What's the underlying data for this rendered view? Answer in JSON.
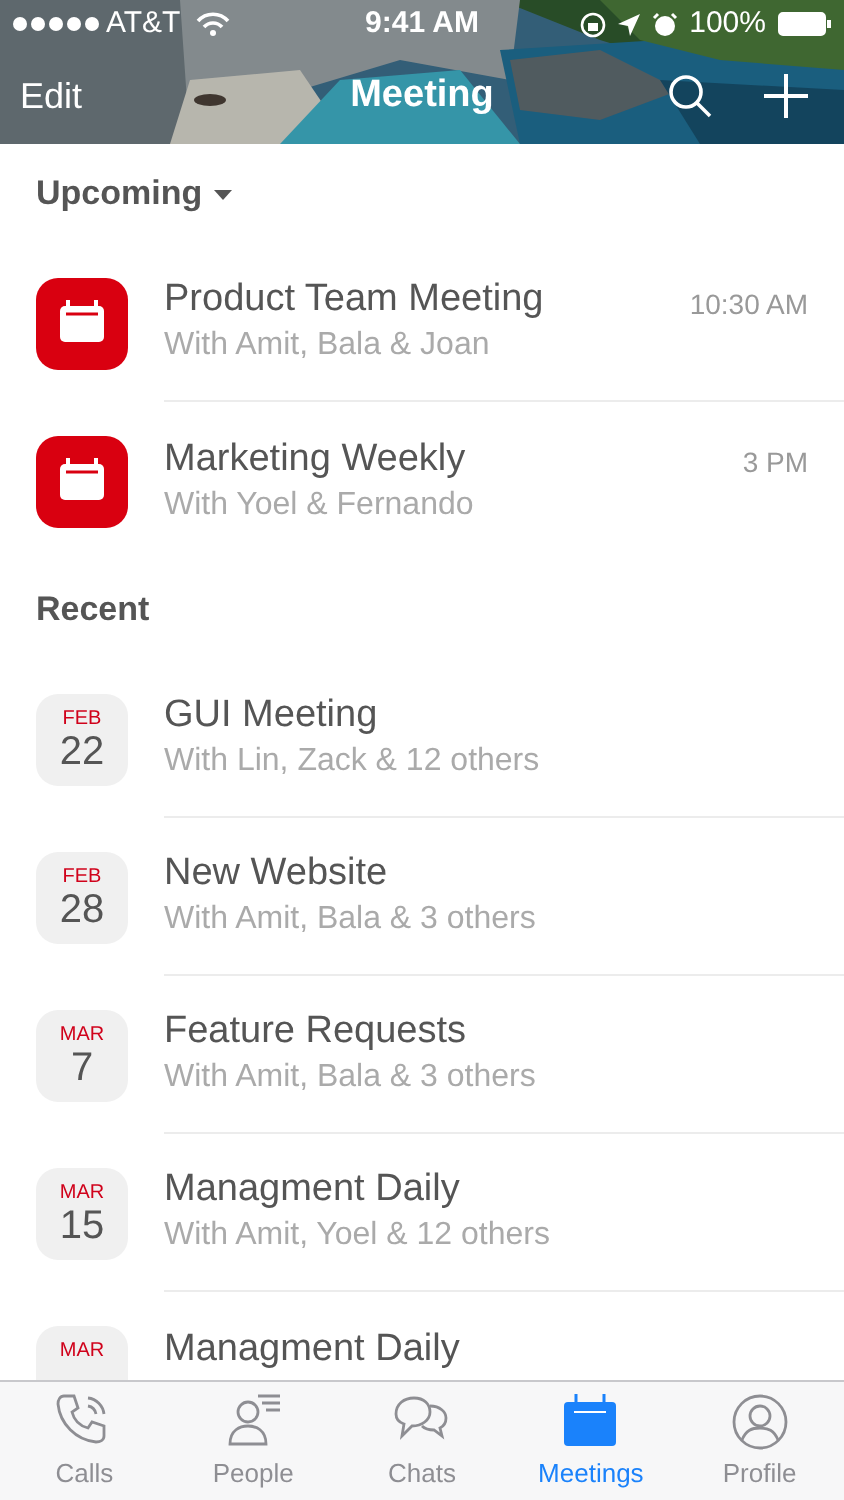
{
  "status_bar": {
    "carrier": "AT&T",
    "time": "9:41 AM",
    "battery": "100%"
  },
  "nav": {
    "left": "Edit",
    "title": "Meeting"
  },
  "sections": [
    {
      "title": "Upcoming",
      "dropdown": true,
      "items": [
        {
          "kind": "upcoming",
          "title": "Product Team Meeting",
          "subtitle": "With Amit, Bala & Joan",
          "time": "10:30 AM"
        },
        {
          "kind": "upcoming",
          "title": "Marketing Weekly",
          "subtitle": "With Yoel & Fernando",
          "time": "3 PM"
        }
      ]
    },
    {
      "title": "Recent",
      "dropdown": false,
      "items": [
        {
          "kind": "recent",
          "month": "FEB",
          "day": "22",
          "title": "GUI Meeting",
          "subtitle": "With Lin, Zack & 12 others"
        },
        {
          "kind": "recent",
          "month": "FEB",
          "day": "28",
          "title": "New Website",
          "subtitle": "With Amit, Bala & 3 others"
        },
        {
          "kind": "recent",
          "month": "MAR",
          "day": "7",
          "title": "Feature Requests",
          "subtitle": "With Amit, Bala & 3 others"
        },
        {
          "kind": "recent",
          "month": "MAR",
          "day": "15",
          "title": "Managment Daily",
          "subtitle": "With Amit, Yoel & 12 others"
        },
        {
          "kind": "recent",
          "month": "MAR",
          "title": "Managment Daily"
        }
      ]
    }
  ],
  "tabs": [
    {
      "kind": "calls",
      "label": "Calls",
      "selected": false
    },
    {
      "kind": "people",
      "label": "People",
      "selected": false
    },
    {
      "kind": "chats",
      "label": "Chats",
      "selected": false
    },
    {
      "kind": "meetings",
      "label": "Meetings",
      "selected": true
    },
    {
      "kind": "profile",
      "label": "Profile",
      "selected": false
    }
  ]
}
